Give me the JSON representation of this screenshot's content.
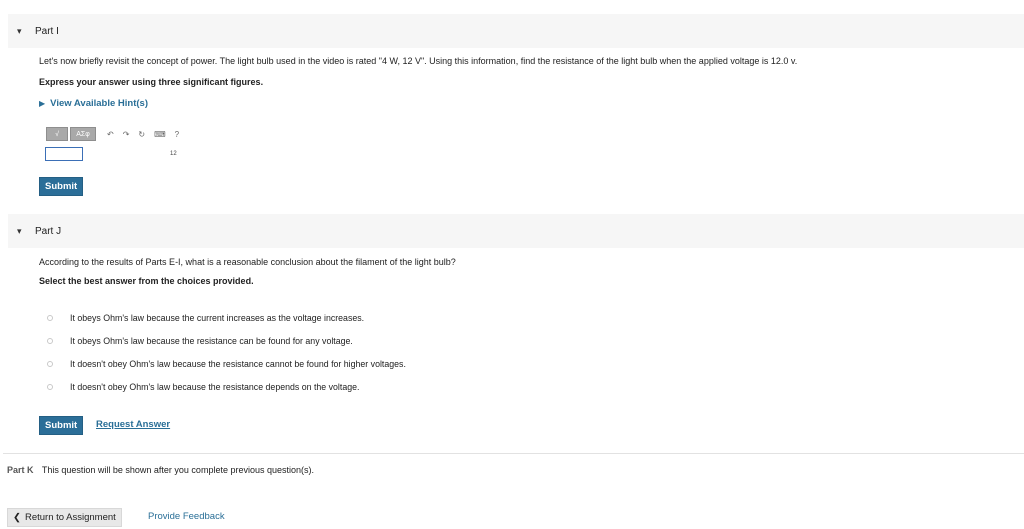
{
  "part_i": {
    "title": "Part I",
    "question": "Let's now briefly revisit the concept of power. The light bulb used in the video is rated \"4 W, 12 V\". Using this information, find the resistance of the light bulb when the applied voltage is 12.0 v.",
    "instruction": "Express your answer using three significant figures.",
    "hint": "View Available Hint(s)",
    "toolbar": {
      "btn1": "√",
      "btn2": "AΣφ"
    },
    "small_text": "12",
    "submit": "Submit"
  },
  "part_j": {
    "title": "Part J",
    "question": "According to the results of Parts E-I, what is a reasonable conclusion about the filament of the light bulb?",
    "instruction": "Select the best answer from the choices provided.",
    "choices": [
      "It obeys Ohm's law because the current increases as the voltage increases.",
      "It obeys Ohm's law because the resistance can be found for any voltage.",
      "It doesn't obey Ohm's law because the resistance cannot be found for higher voltages.",
      "It doesn't obey Ohm's law because the resistance depends on the voltage."
    ],
    "submit": "Submit",
    "request": "Request Answer"
  },
  "part_k": {
    "label": "Part K",
    "text": "This question will be shown after you complete previous question(s)."
  },
  "footer": {
    "back": "Return to Assignment",
    "feedback": "Provide Feedback"
  }
}
